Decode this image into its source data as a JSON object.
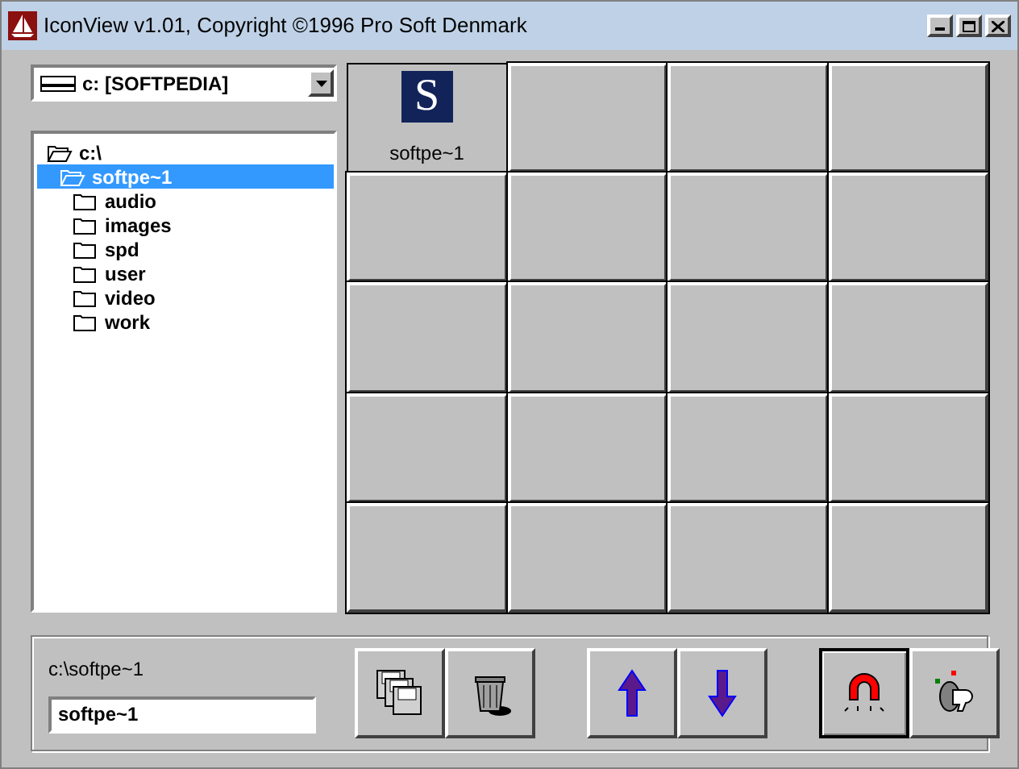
{
  "window": {
    "title": "IconView v1.01, Copyright ©1996 Pro Soft Denmark"
  },
  "drive_select": {
    "value": "c: [SOFTPEDIA]"
  },
  "tree": [
    {
      "label": "c:\\",
      "selected": false,
      "expanded": true,
      "children": [
        {
          "label": "softpe~1",
          "selected": true,
          "expanded": true,
          "children": [
            {
              "label": "audio",
              "selected": false,
              "expanded": false
            },
            {
              "label": "images",
              "selected": false,
              "expanded": false
            },
            {
              "label": "spd",
              "selected": false,
              "expanded": false
            },
            {
              "label": "user",
              "selected": false,
              "expanded": false
            },
            {
              "label": "video",
              "selected": false,
              "expanded": false
            },
            {
              "label": "work",
              "selected": false,
              "expanded": false
            }
          ]
        }
      ]
    }
  ],
  "icon_grid": [
    {
      "label": "softpe~1",
      "icon_letter": "S",
      "selected": true
    },
    {
      "selected": false
    },
    {
      "selected": false
    },
    {
      "selected": false
    },
    {
      "selected": false
    },
    {
      "selected": false
    },
    {
      "selected": false
    },
    {
      "selected": false
    },
    {
      "selected": false
    },
    {
      "selected": false
    },
    {
      "selected": false
    },
    {
      "selected": false
    },
    {
      "selected": false
    },
    {
      "selected": false
    },
    {
      "selected": false
    },
    {
      "selected": false
    },
    {
      "selected": false
    },
    {
      "selected": false
    },
    {
      "selected": false
    },
    {
      "selected": false
    }
  ],
  "current_path": "c:\\softpe~1",
  "name_field": {
    "value": "softpe~1"
  },
  "toolbar": [
    {
      "kind": "copy",
      "selected": false
    },
    {
      "kind": "delete",
      "selected": false
    },
    {
      "kind": "up",
      "selected": false
    },
    {
      "kind": "down",
      "selected": false
    },
    {
      "kind": "magnet",
      "selected": true
    },
    {
      "kind": "key",
      "selected": false
    }
  ]
}
